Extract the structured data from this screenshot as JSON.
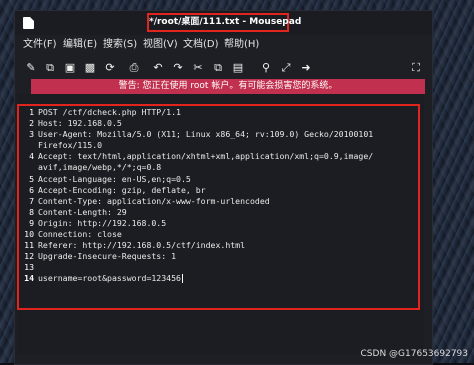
{
  "window": {
    "title": "*/root/桌面/111.txt - Mousepad"
  },
  "menu": {
    "items": [
      "文件(F)",
      "编辑(E)",
      "搜索(S)",
      "视图(V)",
      "文档(D)",
      "帮助(H)"
    ]
  },
  "toolbar": {
    "icons": [
      "new-document-icon",
      "new-window-icon",
      "save-icon",
      "save-as-icon",
      "reload-icon",
      "print-icon",
      "undo-icon",
      "redo-icon",
      "cut-icon",
      "copy-icon",
      "paste-icon",
      "find-icon",
      "find-replace-icon",
      "go-to-icon",
      "fullscreen-icon"
    ]
  },
  "warning": {
    "text": "警告: 您正在使用 root 帐户。有可能会损害您的系统。"
  },
  "editor": {
    "lines": [
      {
        "num": "1",
        "text": "POST /ctf/dcheck.php HTTP/1.1"
      },
      {
        "num": "2",
        "text": "Host: 192.168.0.5"
      },
      {
        "num": "3",
        "text": "User-Agent: Mozilla/5.0 (X11; Linux x86_64; rv:109.0) Gecko/20100101"
      },
      {
        "num": "",
        "text": "Firefox/115.0"
      },
      {
        "num": "4",
        "text": "Accept: text/html,application/xhtml+xml,application/xml;q=0.9,image/"
      },
      {
        "num": "",
        "text": "avif,image/webp,*/*;q=0.8"
      },
      {
        "num": "5",
        "text": "Accept-Language: en-US,en;q=0.5"
      },
      {
        "num": "6",
        "text": "Accept-Encoding: gzip, deflate, br"
      },
      {
        "num": "7",
        "text": "Content-Type: application/x-www-form-urlencoded"
      },
      {
        "num": "8",
        "text": "Content-Length: 29"
      },
      {
        "num": "9",
        "text": "Origin: http://192.168.0.5"
      },
      {
        "num": "10",
        "text": "Connection: close"
      },
      {
        "num": "11",
        "text": "Referer: http://192.168.0.5/ctf/index.html"
      },
      {
        "num": "12",
        "text": "Upgrade-Insecure-Requests: 1"
      },
      {
        "num": "13",
        "text": ""
      },
      {
        "num": "14",
        "text": "username=root&password=123456"
      }
    ]
  },
  "watermark": {
    "text": "CSDN @G17653692793"
  }
}
